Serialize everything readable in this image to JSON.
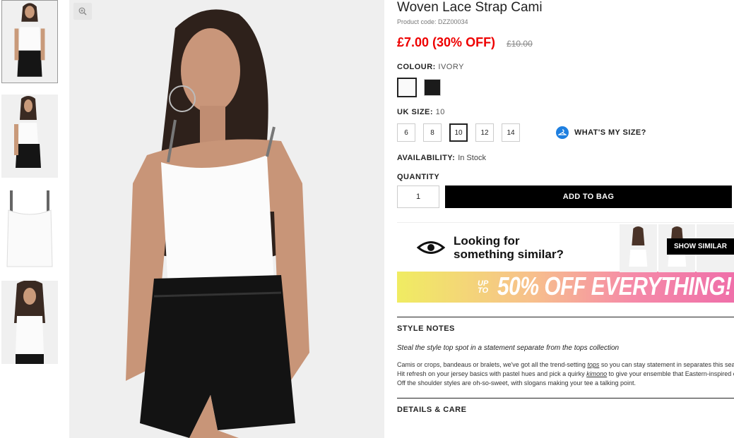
{
  "product": {
    "title": "Woven Lace Strap Cami",
    "code": "Product code: DZZ00034",
    "price": "£7.00 (30% OFF)",
    "was_price": "£10.00"
  },
  "colour": {
    "label": "COLOUR:",
    "value": "IVORY",
    "options": [
      "ivory",
      "black"
    ]
  },
  "size": {
    "label": "UK SIZE:",
    "value": "10",
    "options": [
      "6",
      "8",
      "10",
      "12",
      "14"
    ],
    "whats_my_size": "WHAT'S MY SIZE?"
  },
  "availability": {
    "label": "AVAILABILITY:",
    "value": "In Stock"
  },
  "quantity": {
    "label": "QUANTITY",
    "value": "1",
    "add_to_bag": "ADD TO BAG"
  },
  "similar": {
    "line1": "Looking for",
    "line2": "something similar?",
    "button": "SHOW SIMILAR"
  },
  "promo": {
    "upto": "UP TO",
    "text": "50% OFF EVERYTHING!"
  },
  "style_notes": {
    "heading": "STYLE NOTES",
    "tagline": "Steal the style top spot in a statement separate from the tops collection",
    "body_1": "Camis or crops, bandeaus or bralets, we've got all the trend-setting ",
    "link_tops": "tops",
    "body_2": " so you can stay statement in separates this season. Hit refresh on your jersey basics with pastel hues and pick a quirky ",
    "link_kimono": "kimono",
    "body_3": " to give your ensemble that Eastern-inspired edge. Off the shoulder styles are oh-so-sweet, with slogans making your tee a talking point."
  },
  "details": {
    "heading": "DETAILS & CARE"
  },
  "icons": {
    "zoom": "zoom-in-icon",
    "size_guide": "hanger-icon",
    "eye": "eye-icon"
  },
  "colors": {
    "price_red": "#e00000",
    "brand_blue": "#1e7fe0"
  }
}
